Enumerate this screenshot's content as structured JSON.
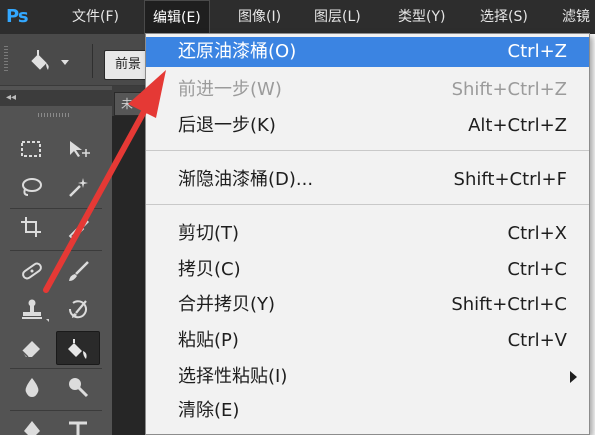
{
  "app": {
    "logo": "Ps",
    "accent_color": "#33a8ff"
  },
  "menubar": {
    "items": [
      {
        "label": "文件(F)"
      },
      {
        "label": "编辑(E)",
        "active": true
      },
      {
        "label": "图像(I)"
      },
      {
        "label": "图层(L)"
      },
      {
        "label": "类型(Y)"
      },
      {
        "label": "选择(S)"
      },
      {
        "label": "滤镜"
      }
    ]
  },
  "optionsbar": {
    "tool_icon": "paint-bucket-icon",
    "fill_source_value": "前景"
  },
  "toolbar": {
    "collapse_glyph": "◂◂",
    "tools": [
      {
        "name": "rectangular-marquee-icon"
      },
      {
        "name": "move-icon"
      },
      {
        "name": "lasso-icon"
      },
      {
        "name": "magic-wand-icon"
      },
      {
        "name": "crop-icon"
      },
      {
        "name": "eyedropper-icon"
      },
      {
        "name": "spot-healing-brush-icon"
      },
      {
        "name": "brush-icon"
      },
      {
        "name": "clone-stamp-icon"
      },
      {
        "name": "history-brush-icon"
      },
      {
        "name": "eraser-icon"
      },
      {
        "name": "paint-bucket-icon",
        "selected": true
      },
      {
        "name": "blur-icon"
      },
      {
        "name": "dodge-icon"
      },
      {
        "name": "pen-icon"
      },
      {
        "name": "type-icon"
      }
    ]
  },
  "document": {
    "tab_label": "未"
  },
  "edit_menu": {
    "items": [
      {
        "label": "还原油漆桶(O)",
        "shortcut": "Ctrl+Z",
        "state": "highlight"
      },
      {
        "label": "前进一步(W)",
        "shortcut": "Shift+Ctrl+Z",
        "state": "disabled"
      },
      {
        "label": "后退一步(K)",
        "shortcut": "Alt+Ctrl+Z",
        "state": "normal"
      },
      {
        "label": "渐隐油漆桶(D)...",
        "shortcut": "Shift+Ctrl+F",
        "state": "normal"
      },
      {
        "label": "剪切(T)",
        "shortcut": "Ctrl+X",
        "state": "normal"
      },
      {
        "label": "拷贝(C)",
        "shortcut": "Ctrl+C",
        "state": "normal"
      },
      {
        "label": "合并拷贝(Y)",
        "shortcut": "Shift+Ctrl+C",
        "state": "normal"
      },
      {
        "label": "粘贴(P)",
        "shortcut": "Ctrl+V",
        "state": "normal"
      },
      {
        "label": "选择性粘贴(I)",
        "shortcut": "",
        "state": "submenu"
      },
      {
        "label": "清除(E)",
        "shortcut": "",
        "state": "normal"
      }
    ],
    "highlight_color": "#3b84e2"
  },
  "annotation": {
    "type": "arrow",
    "color": "#e53935",
    "points_to": "edit_menu.items.0"
  }
}
